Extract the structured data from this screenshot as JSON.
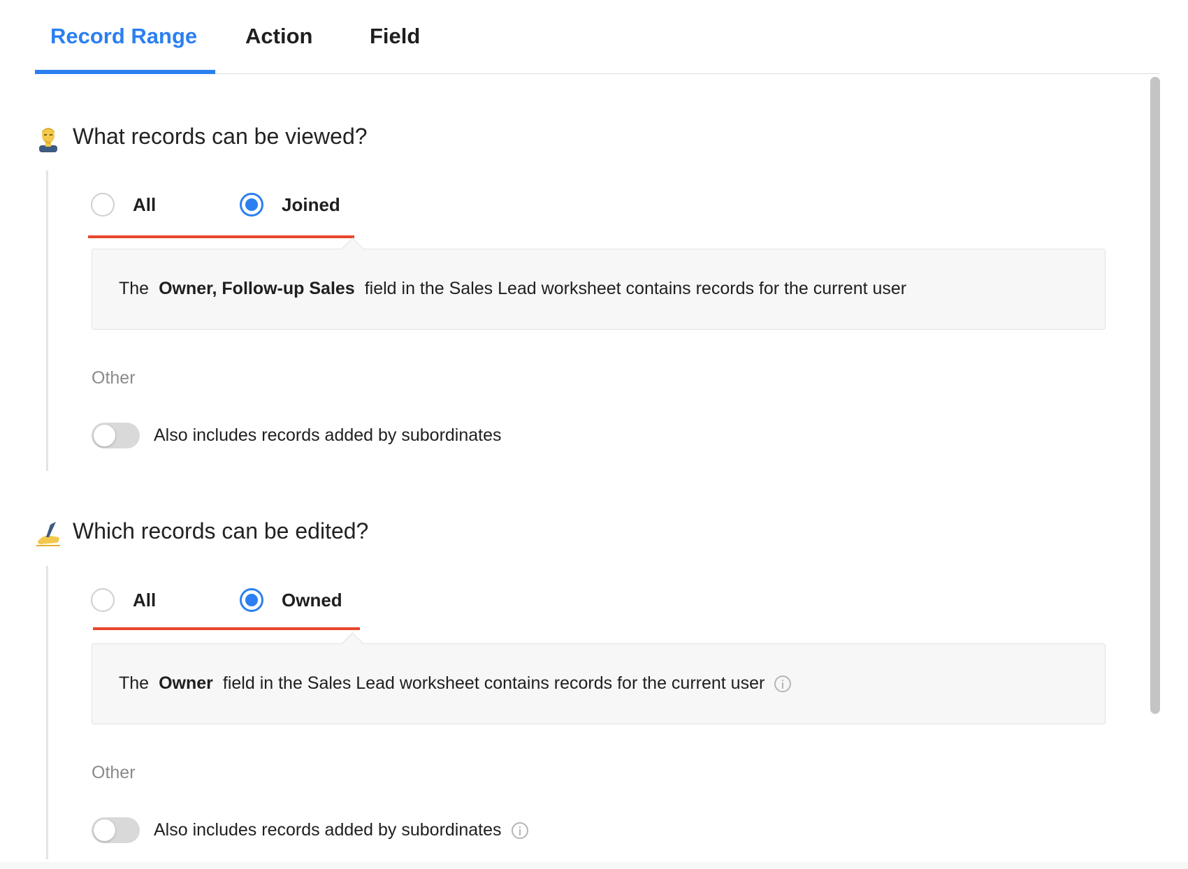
{
  "tabs": [
    {
      "label": "Record Range",
      "active": true
    },
    {
      "label": "Action",
      "active": false
    },
    {
      "label": "Field",
      "active": false
    }
  ],
  "view_section": {
    "icon": "thinking-person-icon",
    "title": "What records can be viewed?",
    "options": [
      {
        "label": "All",
        "checked": false
      },
      {
        "label": "Joined",
        "checked": true
      }
    ],
    "description": {
      "prefix": "The",
      "field": "Owner, Follow-up Sales",
      "suffix": "field in the Sales Lead worksheet contains records for the current user"
    },
    "other_label": "Other",
    "toggle_label": "Also includes records added by subordinates",
    "toggle_on": false
  },
  "edit_section": {
    "icon": "writing-hand-icon",
    "title": "Which records can be edited?",
    "options": [
      {
        "label": "All",
        "checked": false
      },
      {
        "label": "Owned",
        "checked": true
      }
    ],
    "description": {
      "prefix": "The",
      "field": "Owner",
      "suffix": "field in the Sales Lead worksheet contains records for the current user"
    },
    "other_label": "Other",
    "toggle_label": "Also includes records added by subordinates",
    "toggle_on": false
  },
  "colors": {
    "accent": "#2b7ff0",
    "highlight_underline": "#e8452c"
  }
}
